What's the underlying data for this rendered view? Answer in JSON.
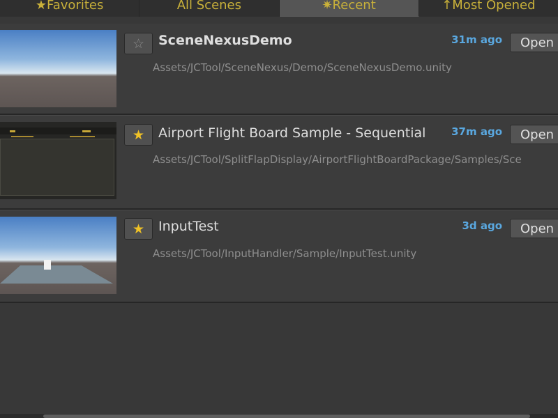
{
  "tabs": [
    {
      "label": "★Favorites",
      "active": false
    },
    {
      "label": "All Scenes",
      "active": false
    },
    {
      "label": "✷Recent",
      "active": true
    },
    {
      "label": "↑Most Opened",
      "active": false
    }
  ],
  "scenes": [
    {
      "name": "SceneNexusDemo",
      "path": "Assets/JCTool/SceneNexus/Demo/SceneNexusDemo.unity",
      "time": "31m ago",
      "favorite": false,
      "star": "☆",
      "open_label": "Open"
    },
    {
      "name": "Airport Flight Board Sample - Sequential",
      "path": "Assets/JCTool/SplitFlapDisplay/AirportFlightBoardPackage/Samples/Sce",
      "time": "37m ago",
      "favorite": true,
      "star": "★",
      "open_label": "Open"
    },
    {
      "name": "InputTest",
      "path": "Assets/JCTool/InputHandler/Sample/InputTest.unity",
      "time": "3d ago",
      "favorite": true,
      "star": "★",
      "open_label": "Open"
    }
  ],
  "colors": {
    "accent_tab": "#c9b13a",
    "time": "#5aa8e0",
    "star_on": "#f0c226"
  }
}
